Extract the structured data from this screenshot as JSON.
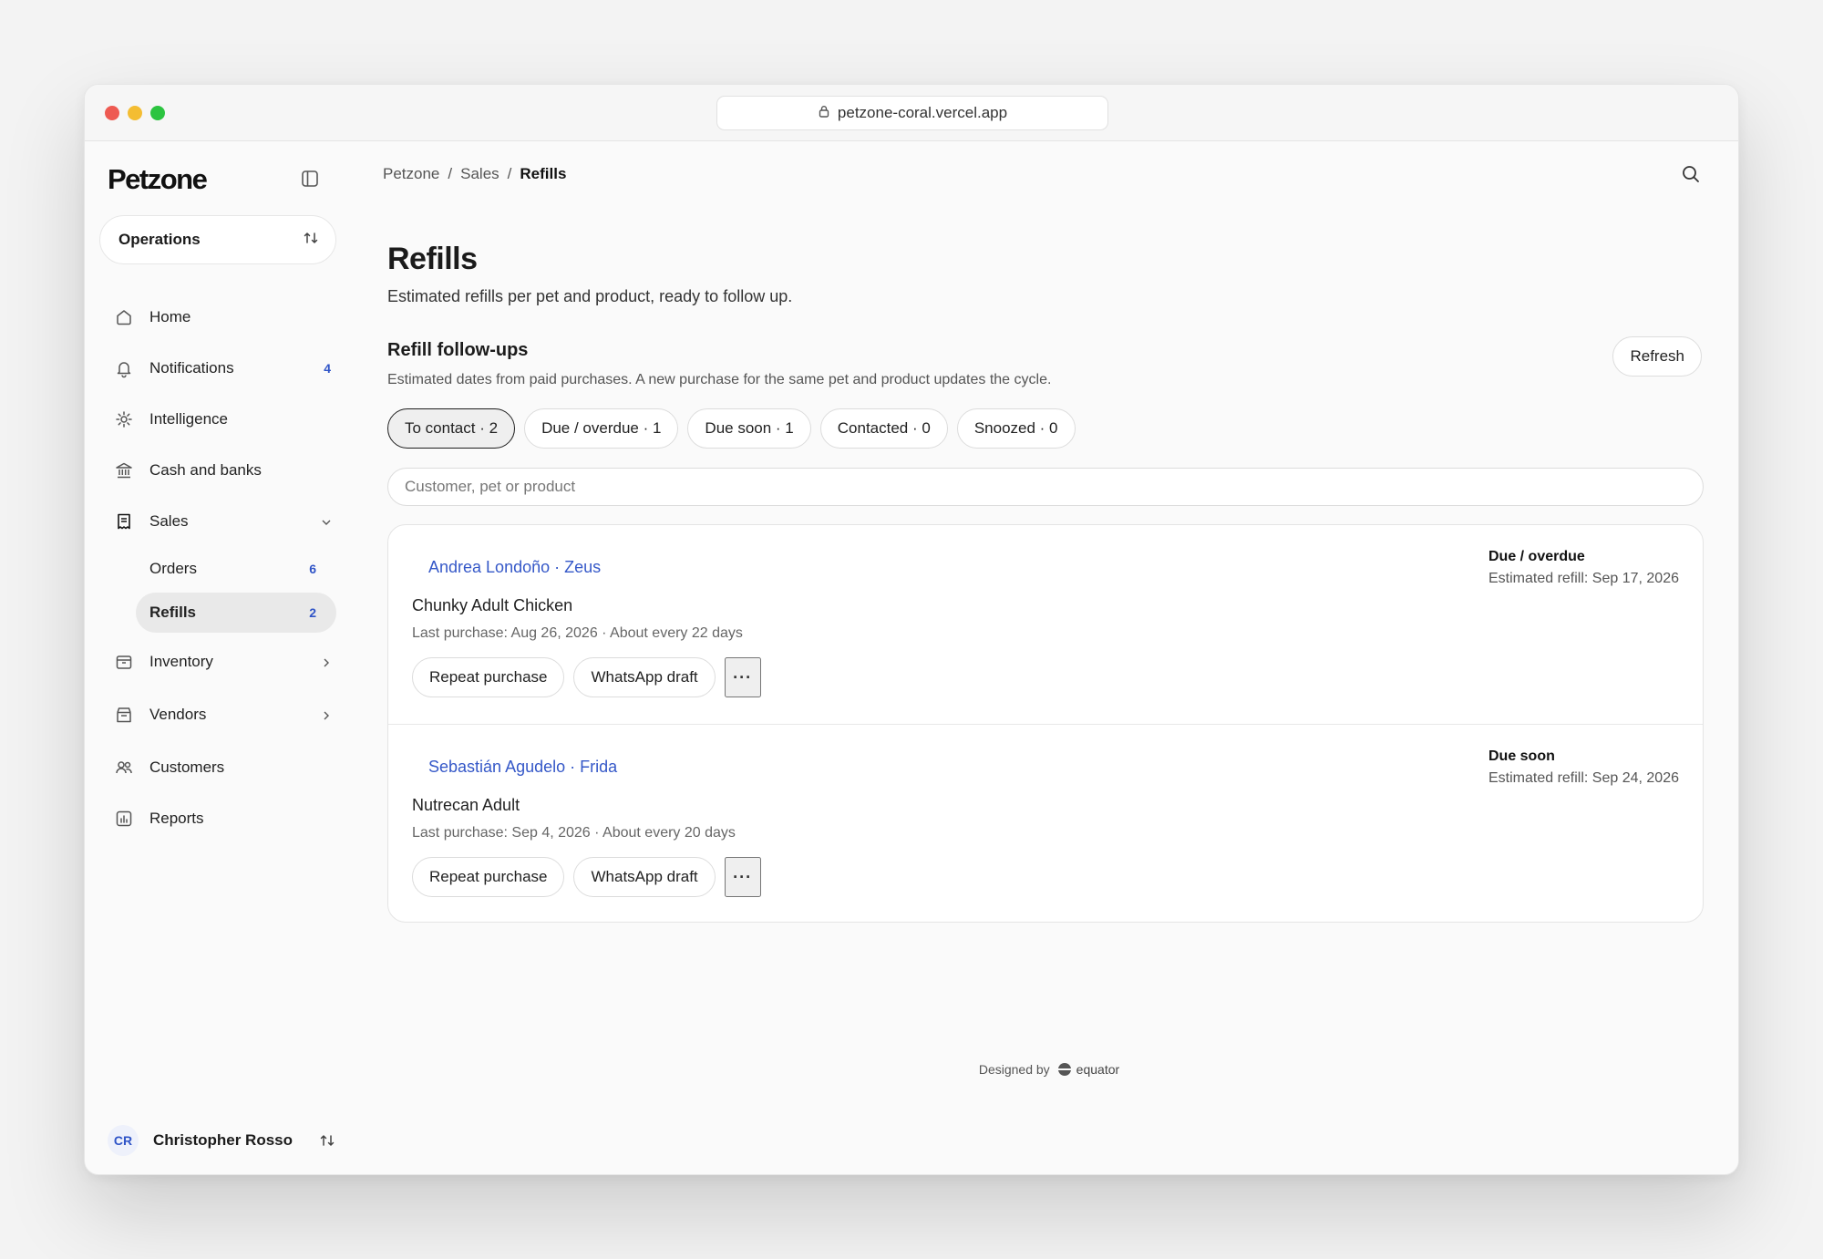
{
  "browser": {
    "url": "petzone-coral.vercel.app"
  },
  "sidebar": {
    "logo": "Petzone",
    "workspace": "Operations",
    "items": [
      {
        "label": "Home",
        "icon": "home-icon"
      },
      {
        "label": "Notifications",
        "icon": "bell-icon",
        "badge": "4"
      },
      {
        "label": "Intelligence",
        "icon": "gear-icon"
      },
      {
        "label": "Cash and banks",
        "icon": "bank-icon"
      },
      {
        "label": "Sales",
        "icon": "receipt-icon"
      },
      {
        "label": "Inventory",
        "icon": "box-icon"
      },
      {
        "label": "Vendors",
        "icon": "store-icon"
      },
      {
        "label": "Customers",
        "icon": "users-icon"
      },
      {
        "label": "Reports",
        "icon": "chart-icon"
      }
    ],
    "sales_sub": [
      {
        "label": "Orders",
        "badge": "6"
      },
      {
        "label": "Refills",
        "badge": "2"
      }
    ],
    "user": {
      "initials": "CR",
      "name": "Christopher Rosso"
    }
  },
  "breadcrumb": [
    "Petzone",
    "Sales",
    "Refills"
  ],
  "page": {
    "title": "Refills",
    "subtitle": "Estimated refills per pet and product, ready to follow up."
  },
  "section": {
    "title": "Refill follow-ups",
    "subtitle": "Estimated dates from paid purchases. A new purchase for the same pet and product updates the cycle.",
    "refresh_label": "Refresh"
  },
  "filters": [
    {
      "label": "To contact · 2",
      "active": true
    },
    {
      "label": "Due / overdue · 1"
    },
    {
      "label": "Due soon · 1"
    },
    {
      "label": "Contacted · 0"
    },
    {
      "label": "Snoozed · 0"
    }
  ],
  "search": {
    "placeholder": "Customer, pet or product"
  },
  "refills": [
    {
      "who": "Andrea Londoño · Zeus",
      "product": "Chunky Adult Chicken",
      "meta": "Last purchase: Aug 26, 2026 · About every 22 days",
      "status": "Due / overdue",
      "estimate": "Estimated refill: Sep 17, 2026",
      "repeat_label": "Repeat purchase",
      "whatsapp_label": "WhatsApp draft",
      "more_label": "···"
    },
    {
      "who": "Sebastián Agudelo · Frida",
      "product": "Nutrecan Adult",
      "meta": "Last purchase: Sep 4, 2026 · About every 20 days",
      "status": "Due soon",
      "estimate": "Estimated refill: Sep 24, 2026",
      "repeat_label": "Repeat purchase",
      "whatsapp_label": "WhatsApp draft",
      "more_label": "···"
    }
  ],
  "footer": {
    "prefix": "Designed by",
    "brand": "equator"
  },
  "colors": {
    "accent": "#3558c8",
    "badge": "#2f54c7",
    "active_bg": "#e9e9e9"
  }
}
